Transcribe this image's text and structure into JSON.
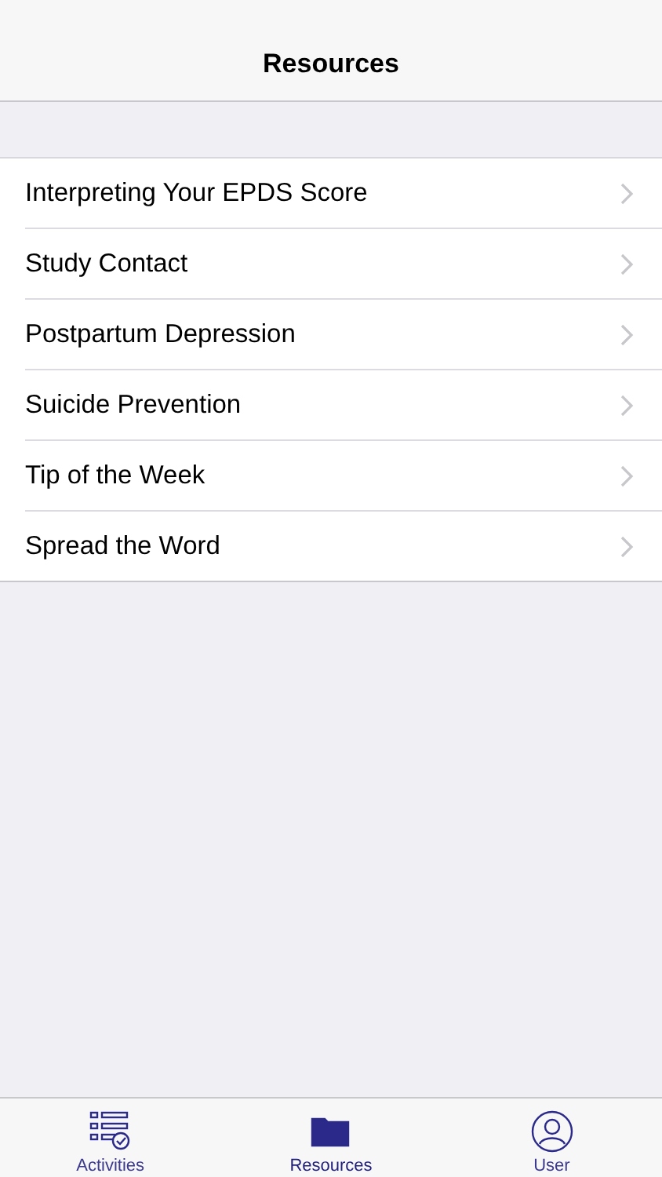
{
  "nav_bar": {
    "title": "Resources"
  },
  "resources": [
    {
      "label": "Interpreting Your EPDS Score"
    },
    {
      "label": "Study Contact"
    },
    {
      "label": "Postpartum Depression"
    },
    {
      "label": "Suicide Prevention"
    },
    {
      "label": "Tip of the Week"
    },
    {
      "label": "Spread the Word"
    }
  ],
  "tab_bar": [
    {
      "kind": "activities",
      "label": "Activities",
      "selected": false
    },
    {
      "kind": "resources",
      "label": "Resources",
      "selected": true
    },
    {
      "kind": "user",
      "label": "User",
      "selected": false
    }
  ]
}
